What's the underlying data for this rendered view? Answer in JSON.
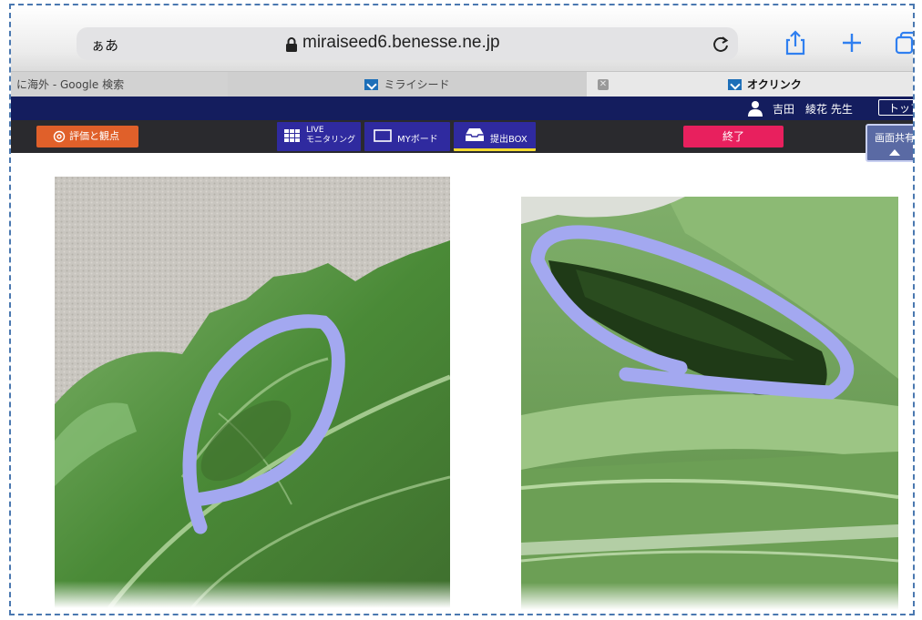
{
  "browser": {
    "text_size_label": "ぁあ",
    "url": "miraiseed6.benesse.ne.jp",
    "icons": [
      "lock-icon",
      "reload-icon",
      "share-icon",
      "new-tab-icon",
      "tabs-icon"
    ]
  },
  "tabs": [
    {
      "label": "に海外 - Google 検索"
    },
    {
      "label": "ミライシード"
    },
    {
      "label": "オクリンク",
      "active": true
    }
  ],
  "app": {
    "user_name": "吉田　綾花 先生",
    "top_button": "トップ",
    "toolbar": {
      "eval_label": "評価と観点",
      "live_label_line1": "LIVE",
      "live_label_line2": "モニタリング",
      "myboard_label": "MYボード",
      "submit_box_label": "提出BOX",
      "end_label": "終了"
    },
    "share_button": "画面共有"
  },
  "colors": {
    "header_navy": "#141d5e",
    "toolbar_dark": "#2a2a2e",
    "eval_orange": "#e0602a",
    "tool_purple": "#2f2a9f",
    "end_pink": "#e8205e",
    "annotation_lavender": "#a3a8f0",
    "leaf_green": "#4f8a3a"
  },
  "photos": [
    {
      "name": "cabbage-leaf-photo",
      "annotation": "circled-caterpillar"
    },
    {
      "name": "folded-leaf-photo",
      "annotation": "circled-caterpillar"
    }
  ]
}
